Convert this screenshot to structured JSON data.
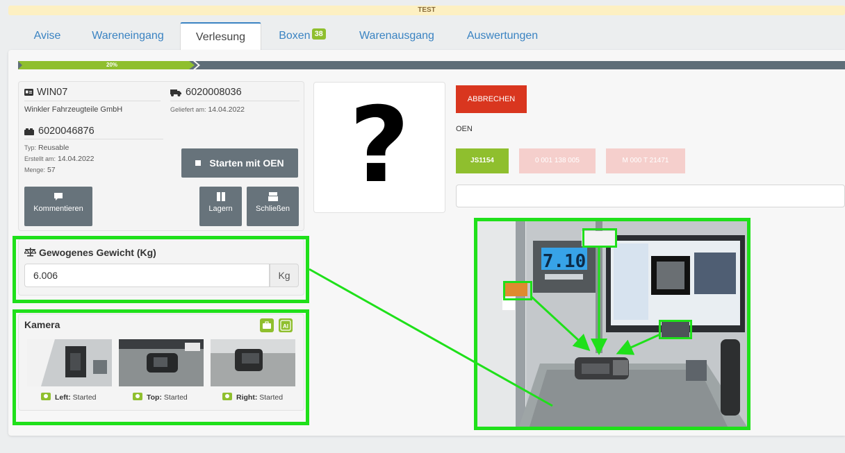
{
  "banner": "TEST",
  "tabs": [
    {
      "label": "Avise"
    },
    {
      "label": "Wareneingang"
    },
    {
      "label": "Verlesung"
    },
    {
      "label": "Boxen",
      "badge": "38"
    },
    {
      "label": "Warenausgang"
    },
    {
      "label": "Auswertungen"
    }
  ],
  "progress": {
    "label": "20%",
    "value": 0.2
  },
  "order": {
    "customer_id": "WIN07",
    "customer_name": "Winkler Fahrzeugteile GmbH",
    "delivery_id": "6020008036",
    "delivered_label": "Geliefert am:",
    "delivered_date": "14.04.2022",
    "box_id": "6020046876",
    "type_label": "Typ:",
    "type_value": "Reusable",
    "created_label": "Erstellt am:",
    "created_date": "14.04.2022",
    "qty_label": "Menge:",
    "qty_value": "57"
  },
  "buttons": {
    "start_oen": "Starten mit OEN",
    "comment": "Kommentieren",
    "store": "Lagern",
    "close": "Schließen",
    "cancel": "ABBRECHEN"
  },
  "oen": {
    "label": "OEN",
    "options": [
      {
        "label": "JS1154",
        "state": "selected"
      },
      {
        "label": "0 001 138 005",
        "state": "inactive"
      },
      {
        "label": "M 000 T 21471",
        "state": "inactive"
      }
    ],
    "input_value": ""
  },
  "weight": {
    "title": "Gewogenes Gewicht (Kg)",
    "value": "6.006",
    "unit": "Kg"
  },
  "camera": {
    "title": "Kamera",
    "cams": [
      {
        "name": "Left:",
        "status": "Started"
      },
      {
        "name": "Top:",
        "status": "Started"
      },
      {
        "name": "Right:",
        "status": "Started"
      }
    ]
  },
  "scale_display": "7.10",
  "colors": {
    "accent": "#3a83c2",
    "green": "#8fbf2e",
    "highlight": "#1fe01a",
    "danger": "#d9361f",
    "slate": "#67737b"
  }
}
